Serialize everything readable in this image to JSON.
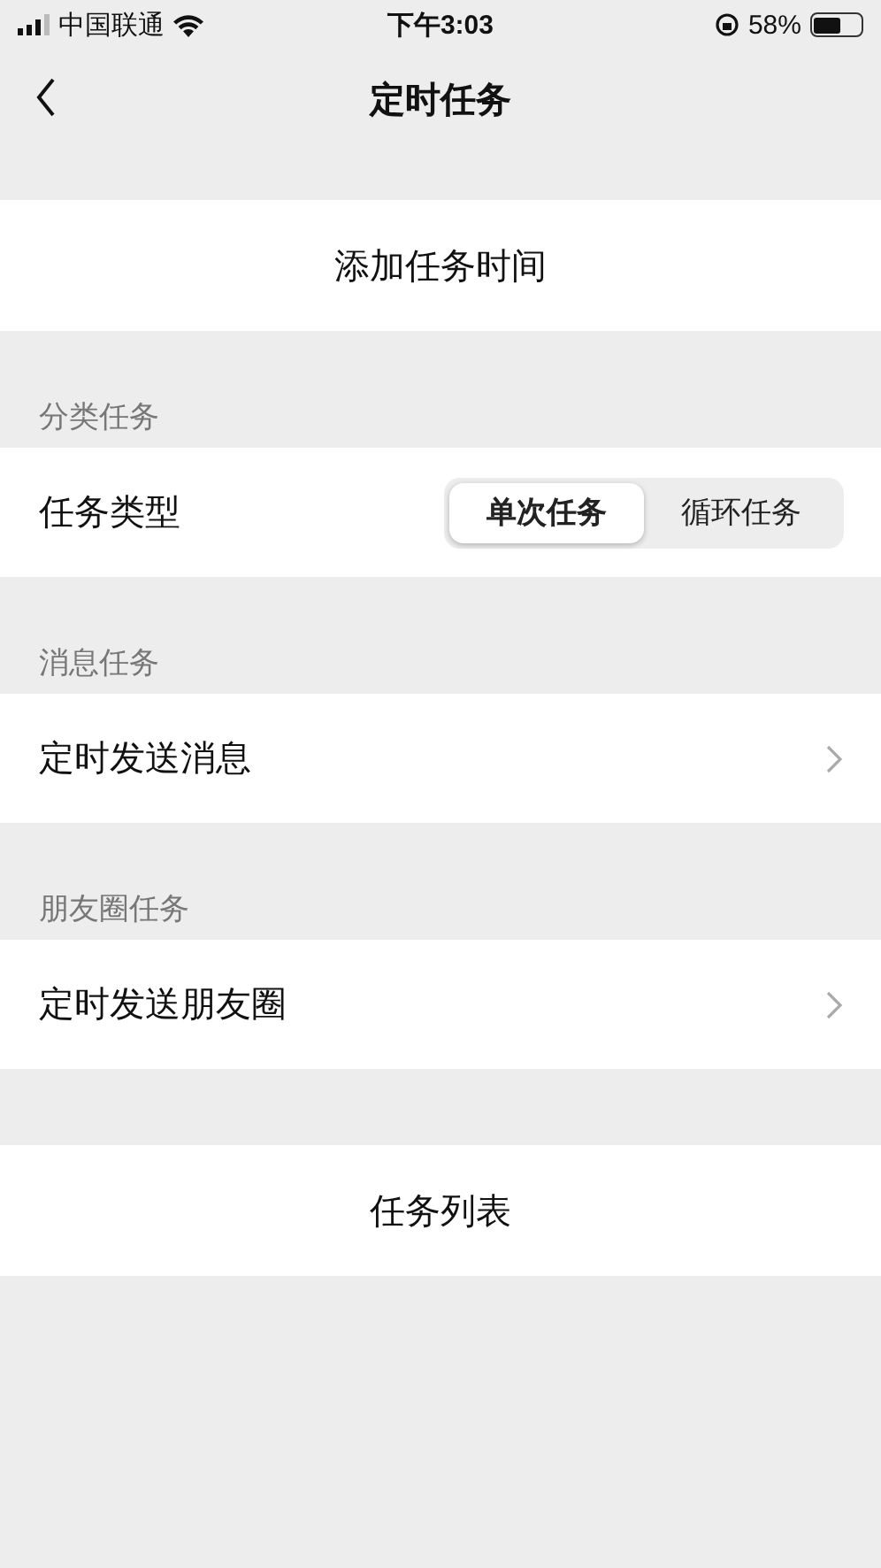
{
  "status_bar": {
    "carrier": "中国联通",
    "time": "下午3:03",
    "battery": "58%"
  },
  "nav": {
    "title": "定时任务"
  },
  "blocks": [
    {
      "kind": "action",
      "label": "添加任务时间"
    },
    {
      "kind": "section",
      "title": "分类任务",
      "row": {
        "kind": "segmented",
        "label": "任务类型",
        "options": [
          {
            "label": "单次任务",
            "selected": true
          },
          {
            "label": "循环任务",
            "selected": false
          }
        ]
      }
    },
    {
      "kind": "section",
      "title": "消息任务",
      "row": {
        "kind": "link",
        "label": "定时发送消息"
      }
    },
    {
      "kind": "section",
      "title": "朋友圈任务",
      "row": {
        "kind": "link",
        "label": "定时发送朋友圈"
      }
    },
    {
      "kind": "action",
      "label": "任务列表"
    }
  ]
}
